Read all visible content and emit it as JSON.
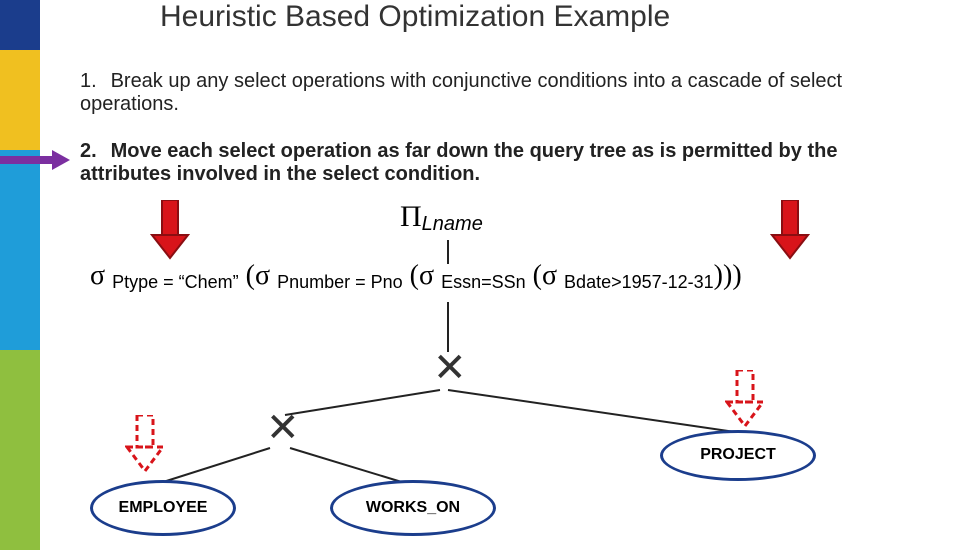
{
  "title": "Heuristic Based Optimization Example",
  "steps": {
    "s1_num": "1.",
    "s1_text": "Break up any select operations with conjunctive conditions into a cascade of select operations.",
    "s2_num": "2.",
    "s2_text": "Move each select operation as far down the query tree as is permitted by the attributes involved in the select condition."
  },
  "pi_sub": "Lname",
  "formula": {
    "sub1": "Ptype = “Chem”",
    "sub2": "Pnumber = Pno",
    "sub3": "Essn=SSn",
    "sub4": "Bdate>1957-12-31",
    "close": ")))"
  },
  "nodes": {
    "employee": "EMPLOYEE",
    "workson": "WORKS_ON",
    "project": "PROJECT"
  },
  "x_symbol": "✕",
  "chart_data": {
    "type": "diagram",
    "description": "Query tree with projection on Lname, cascaded sigma selections, two cartesian products over EMPLOYEE, WORKS_ON, PROJECT; arrows indicate pushing select operations down the tree."
  }
}
